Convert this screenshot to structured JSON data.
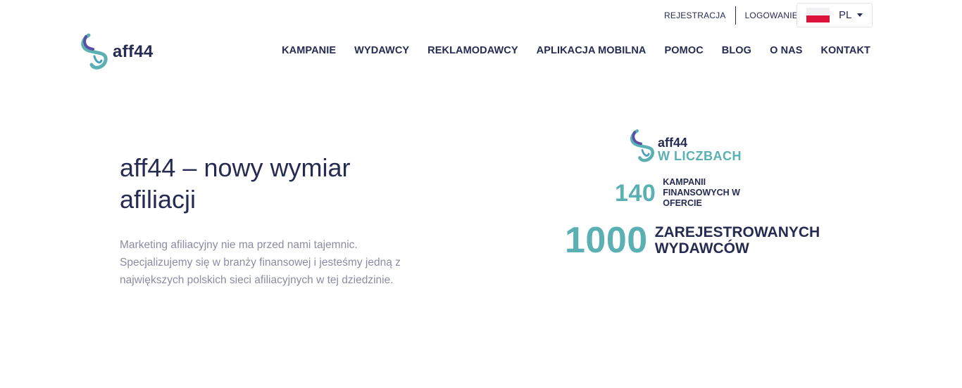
{
  "topbar": {
    "register": "REJESTRACJA",
    "login": "LOGOWANIE"
  },
  "language": {
    "selected": "PL",
    "flag_icon": "poland-flag-icon"
  },
  "brand": {
    "name": "aff44",
    "icon": "aff44-swirl-logo-icon"
  },
  "nav": {
    "items": [
      {
        "label": "KAMPANIE"
      },
      {
        "label": "WYDAWCY"
      },
      {
        "label": "REKLAMODAWCY"
      },
      {
        "label": "APLIKACJA MOBILNA"
      },
      {
        "label": "POMOC"
      },
      {
        "label": "BLOG"
      },
      {
        "label": "O NAS"
      },
      {
        "label": "KONTAKT"
      }
    ]
  },
  "hero": {
    "title": "aff44 – nowy wymiar afiliacji",
    "text": "Marketing afiliacyjny nie ma przed nami tajemnic. Specjalizujemy się w branży finansowej i jesteśmy jedną z największych polskich sieci afiliacyjnych w tej dziedzinie."
  },
  "stats_graphic": {
    "brand": "aff44",
    "subtitle": "W LICZBACH",
    "items": [
      {
        "number": "140",
        "label": "KAMPANII FINANSOWYCH W OFERCIE"
      },
      {
        "number": "1000",
        "label": "ZAREJESTROWANYCH WYDAWCÓW"
      }
    ]
  },
  "colors": {
    "navy": "#262b52",
    "teal": "#5ab0b3",
    "gray_text": "#8a8ca3",
    "logo_purple": "#5b4fa3"
  }
}
